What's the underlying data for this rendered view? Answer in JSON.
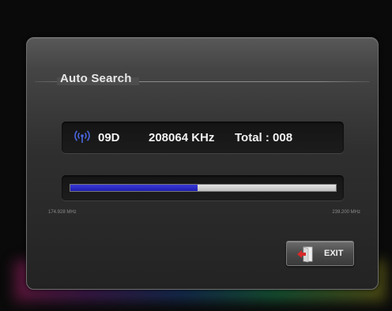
{
  "dialog": {
    "title": "Auto Search"
  },
  "scan": {
    "channel": "09D",
    "frequency": "208064 KHz",
    "total": "Total : 008",
    "progress_fraction": 0.48,
    "range_min": "174.928 MHz",
    "range_max": "239.200 MHz"
  },
  "actions": {
    "exit_label": "EXIT",
    "exit_icon": "exit-door-icon"
  },
  "icons": {
    "signal": "signal-antenna-icon"
  },
  "colors": {
    "progress_fill": "#2a2ac8",
    "signal_icon": "#3f5bd8",
    "exit_icon": "#d92a2a"
  }
}
